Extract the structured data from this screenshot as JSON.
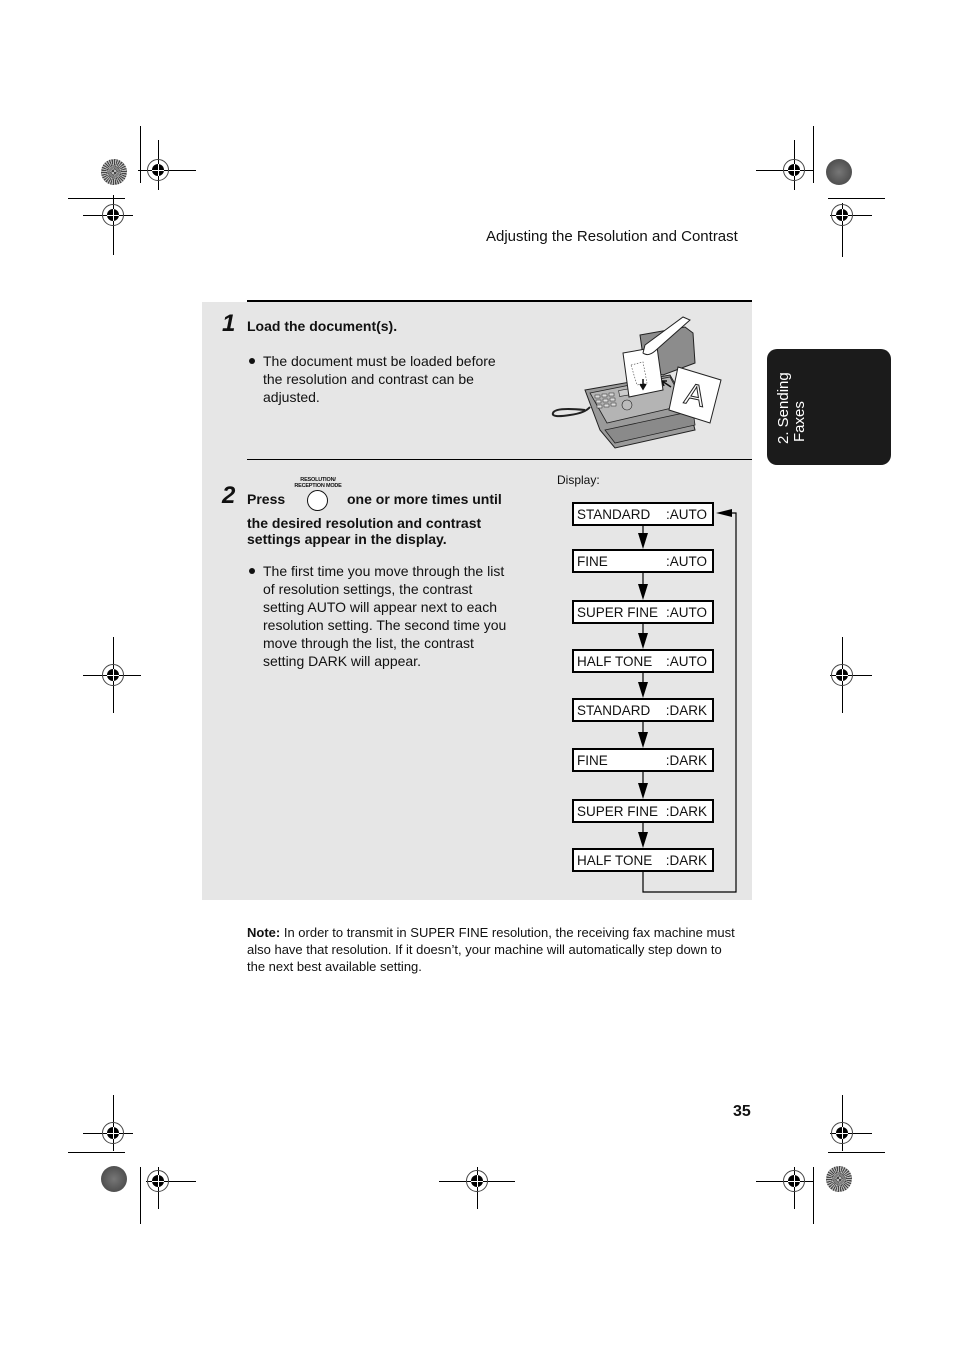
{
  "header": {
    "title": "Adjusting the Resolution and Contrast"
  },
  "side_tab": {
    "line1": "2. Sending",
    "line2": "Faxes"
  },
  "steps": [
    {
      "number": "1",
      "heading": "Load the document(s).",
      "bullets": [
        [
          "The document must be loaded before",
          "the resolution and contrast can be",
          "adjusted."
        ]
      ],
      "illustration": "fax-machine-loading-document"
    },
    {
      "number": "2",
      "heading_press": "Press",
      "heading_rest_line1": "one or more times until",
      "heading_line2": "the desired resolution and contrast",
      "heading_line3": "settings appear in the display.",
      "button_label_line1": "RESOLUTION/",
      "button_label_line2": "RECEPTION MODE",
      "bullets": [
        [
          "The first time you move through the list",
          "of resolution settings, the contrast",
          "setting AUTO will appear next to each",
          "resolution setting. The second time you",
          "move through the list, the contrast",
          "setting DARK will appear."
        ]
      ]
    }
  ],
  "display": {
    "label": "Display:",
    "sequence": [
      {
        "resolution": "STANDARD",
        "contrast": ":AUTO"
      },
      {
        "resolution": "FINE",
        "contrast": ":AUTO"
      },
      {
        "resolution": "SUPER FINE",
        "contrast": ":AUTO"
      },
      {
        "resolution": "HALF TONE",
        "contrast": ":AUTO"
      },
      {
        "resolution": "STANDARD",
        "contrast": ":DARK"
      },
      {
        "resolution": "FINE",
        "contrast": ":DARK"
      },
      {
        "resolution": "SUPER FINE",
        "contrast": ":DARK"
      },
      {
        "resolution": "HALF TONE",
        "contrast": ":DARK"
      }
    ]
  },
  "note": {
    "label": "Note:",
    "text": " In order to transmit in SUPER FINE resolution, the receiving fax machine must also have that resolution. If it doesn’t, your machine will automatically step down to the next best available setting."
  },
  "page_number": "35"
}
